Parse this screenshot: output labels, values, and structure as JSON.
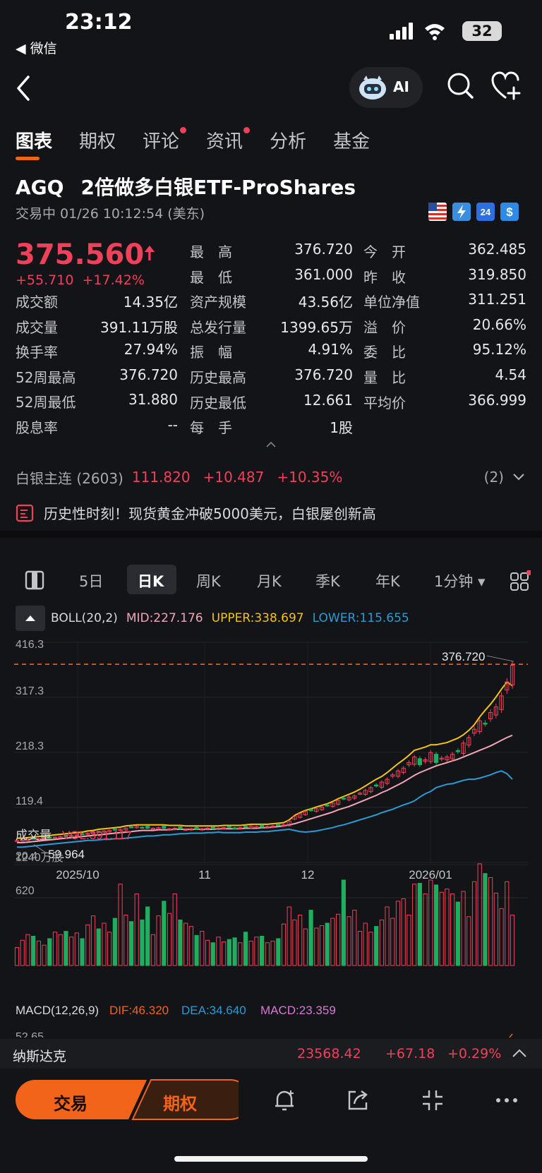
{
  "status_bar": {
    "time": "23:12",
    "back_app": "◀ 微信",
    "battery": "32"
  },
  "nav": {
    "ai_label": "AI"
  },
  "tabs": [
    {
      "label": "图表",
      "active": true,
      "dot": false
    },
    {
      "label": "期权",
      "active": false,
      "dot": false
    },
    {
      "label": "评论",
      "active": false,
      "dot": true
    },
    {
      "label": "资讯",
      "active": false,
      "dot": true
    },
    {
      "label": "分析",
      "active": false,
      "dot": false
    },
    {
      "label": "基金",
      "active": false,
      "dot": false
    }
  ],
  "stock": {
    "symbol": "AGQ",
    "name": "2倍做多白银ETF-ProShares",
    "trade_status": "交易中 01/26 10:12:54 (美东)",
    "price": "375.560",
    "change": "+55.710",
    "change_pct": "+17.42%"
  },
  "quote_cols": [
    [
      {
        "label": "成交额",
        "value": "14.35亿"
      },
      {
        "label": "成交量",
        "value": "391.11万股"
      },
      {
        "label": "换手率",
        "value": "27.94%"
      },
      {
        "label": "52周最高",
        "value": "376.720"
      },
      {
        "label": "52周最低",
        "value": "31.880"
      },
      {
        "label": "股息率",
        "value": "--"
      }
    ],
    [
      {
        "label": "最　高",
        "value": "376.720",
        "red": true
      },
      {
        "label": "最　低",
        "value": "361.000",
        "red": true
      },
      {
        "label": "资产规模",
        "value": "43.56亿"
      },
      {
        "label": "总发行量",
        "value": "1399.65万"
      },
      {
        "label": "振　幅",
        "value": "4.91%"
      },
      {
        "label": "历史最高",
        "value": "376.720"
      },
      {
        "label": "历史最低",
        "value": "12.661"
      },
      {
        "label": "每　手",
        "value": "1股"
      }
    ],
    [
      {
        "label": "今　开",
        "value": "362.485",
        "red": true
      },
      {
        "label": "昨　收",
        "value": "319.850"
      },
      {
        "label": "单位净值",
        "value": "311.251"
      },
      {
        "label": "溢　价",
        "value": "20.66%"
      },
      {
        "label": "委　比",
        "value": "95.12%"
      },
      {
        "label": "量　比",
        "value": "4.54"
      },
      {
        "label": "平均价",
        "value": "366.999"
      }
    ]
  ],
  "futures": {
    "name": "白银主连 (2603)",
    "price": "111.820",
    "change": "+10.487",
    "pct": "+10.35%",
    "count": "(2)"
  },
  "news": "历史性时刻！现货黄金冲破5000美元，白银屡创新高",
  "chart_tabs": [
    "5日",
    "日K",
    "周K",
    "月K",
    "季K",
    "年K",
    "1分钟"
  ],
  "boll": {
    "label": "BOLL(20,2)",
    "mid": "MID:227.176",
    "upper": "UPPER:338.697",
    "lower": "LOWER:115.655"
  },
  "volume_header": {
    "label": "成交量",
    "vol": "VOL:391.117",
    "axis_top": "1240万股",
    "axis_mid": "620"
  },
  "macd_header": {
    "label": "MACD(12,26,9)",
    "dif": "DIF:46.320",
    "dea": "DEA:34.640",
    "macd": "MACD:23.359",
    "axis_top": "52.65"
  },
  "index_bar": {
    "name": "纳斯达克",
    "value": "23568.42",
    "change": "+67.18",
    "pct": "+0.29%"
  },
  "actions": {
    "trade": "交易",
    "options": "期权"
  },
  "colors": {
    "up": "#f0405a",
    "down": "#1fae5f",
    "accent": "#f2641a",
    "upper": "#f3c316",
    "mid": "#f2a6b7",
    "lower": "#2b9bd6"
  },
  "chart_data": {
    "type": "candlestick",
    "y_ticks": [
      "416.3",
      "317.3",
      "218.3",
      "119.4",
      "20.4"
    ],
    "ylim": [
      20.4,
      416.3
    ],
    "x_ticks": [
      "2025/10",
      "11",
      "12",
      "2026/01"
    ],
    "high_marker": "376.720",
    "low_marker": "59.964",
    "close": [
      60,
      61,
      62,
      63,
      63,
      64,
      65,
      66,
      67,
      68,
      69,
      70,
      72,
      73,
      74,
      76,
      77,
      78,
      79,
      80,
      82,
      84,
      85,
      83,
      82,
      82,
      83,
      82,
      81,
      82,
      81,
      80,
      81,
      80,
      81,
      82,
      81,
      82,
      83,
      84,
      82,
      83,
      84,
      86,
      85,
      84,
      85,
      86,
      87,
      88,
      95,
      103,
      108,
      112,
      114,
      117,
      120,
      123,
      127,
      132,
      135,
      138,
      140,
      145,
      150,
      155,
      158,
      165,
      170,
      178,
      185,
      190,
      200,
      210,
      196,
      205,
      218,
      200,
      208,
      210,
      215,
      220,
      235,
      245,
      260,
      275,
      270,
      290,
      300,
      320,
      345,
      375
    ],
    "upper": [
      64,
      64,
      65,
      66,
      67,
      68,
      69,
      70,
      71,
      72,
      73,
      74,
      75,
      77,
      78,
      80,
      81,
      82,
      83,
      84,
      86,
      87,
      88,
      88,
      88,
      88,
      88,
      88,
      87,
      87,
      87,
      86,
      86,
      86,
      86,
      86,
      86,
      86,
      87,
      87,
      87,
      87,
      88,
      89,
      89,
      89,
      89,
      90,
      91,
      92,
      97,
      105,
      110,
      114,
      117,
      120,
      123,
      126,
      130,
      135,
      139,
      143,
      147,
      152,
      158,
      164,
      170,
      175,
      182,
      190,
      198,
      205,
      213,
      222,
      225,
      228,
      232,
      232,
      234,
      236,
      240,
      244,
      250,
      258,
      268,
      282,
      294,
      305,
      318,
      332,
      345,
      338
    ],
    "mid": [
      56,
      56,
      57,
      58,
      59,
      60,
      61,
      62,
      63,
      64,
      65,
      66,
      67,
      68,
      69,
      70,
      71,
      72,
      73,
      74,
      75,
      76,
      77,
      78,
      78,
      78,
      79,
      79,
      79,
      80,
      80,
      80,
      80,
      80,
      80,
      80,
      80,
      81,
      81,
      81,
      81,
      81,
      82,
      82,
      82,
      83,
      83,
      84,
      85,
      86,
      88,
      90,
      93,
      96,
      99,
      102,
      105,
      108,
      111,
      115,
      118,
      121,
      125,
      129,
      133,
      137,
      141,
      146,
      150,
      155,
      160,
      165,
      171,
      177,
      182,
      186,
      190,
      194,
      197,
      200,
      203,
      206,
      210,
      214,
      218,
      222,
      226,
      230,
      235,
      240,
      245,
      249
    ],
    "lower": [
      48,
      48,
      49,
      50,
      51,
      52,
      53,
      54,
      55,
      56,
      57,
      58,
      59,
      60,
      60,
      61,
      62,
      62,
      63,
      63,
      64,
      65,
      66,
      67,
      68,
      68,
      69,
      70,
      70,
      71,
      72,
      72,
      73,
      73,
      73,
      74,
      74,
      75,
      74,
      74,
      74,
      74,
      75,
      75,
      75,
      76,
      76,
      77,
      78,
      79,
      80,
      78,
      76,
      75,
      76,
      77,
      79,
      81,
      83,
      86,
      88,
      91,
      94,
      97,
      100,
      103,
      106,
      110,
      113,
      116,
      120,
      124,
      127,
      131,
      138,
      144,
      148,
      155,
      158,
      161,
      162,
      165,
      168,
      170,
      170,
      172,
      175,
      178,
      182,
      185,
      180,
      170
    ],
    "volume_scale_max": 1240,
    "volume": [
      220,
      310,
      380,
      360,
      300,
      250,
      330,
      410,
      380,
      420,
      350,
      400,
      330,
      500,
      610,
      450,
      520,
      410,
      580,
      1000,
      620,
      540,
      880,
      560,
      720,
      380,
      610,
      790,
      640,
      880,
      560,
      520,
      480,
      370,
      420,
      310,
      280,
      350,
      290,
      320,
      340,
      280,
      410,
      300,
      350,
      360,
      280,
      300,
      330,
      510,
      720,
      560,
      620,
      450,
      680,
      460,
      490,
      520,
      580,
      630,
      1050,
      600,
      680,
      420,
      520,
      410,
      480,
      560,
      720,
      580,
      790,
      820,
      620,
      1000,
      1010,
      880,
      1050,
      990,
      900,
      940,
      880,
      780,
      910,
      600,
      1030,
      1250,
      1130,
      1080,
      890,
      700,
      1030,
      620
    ],
    "macd_axis_top": "52.65"
  }
}
